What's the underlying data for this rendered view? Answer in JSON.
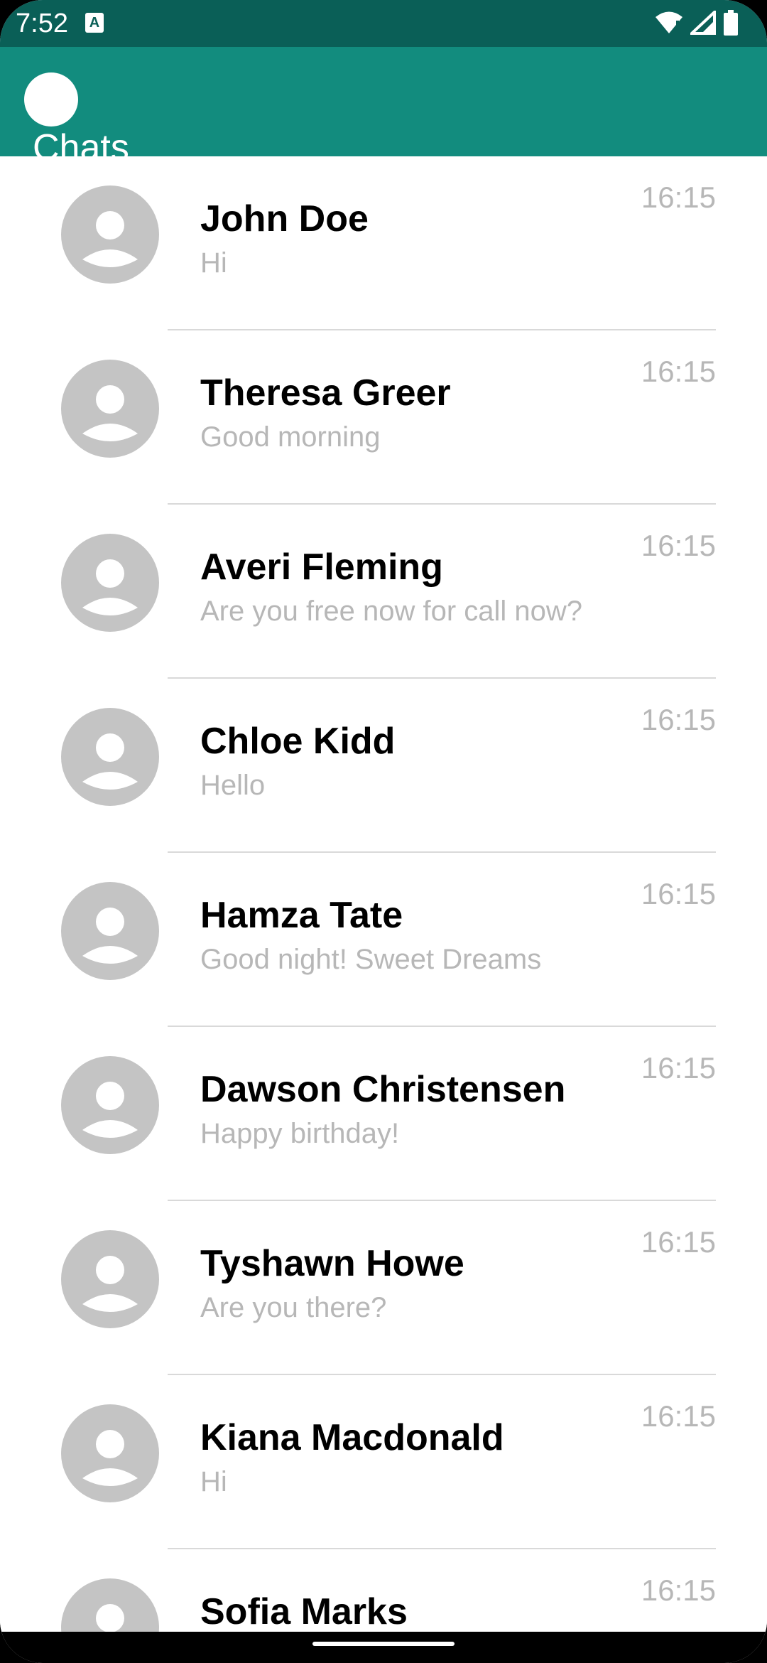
{
  "status_bar": {
    "time": "7:52",
    "a_icon": "A",
    "icons": [
      "wifi-icon",
      "cell-signal-icon",
      "battery-icon"
    ]
  },
  "app_bar": {
    "title": "Chats"
  },
  "colors": {
    "status_bar": "#0a5f57",
    "app_bar": "#128c7e",
    "avatar": "#c4c4c4",
    "secondary_text": "#b7b7b7"
  },
  "chats": [
    {
      "name": "John Doe",
      "message": "Hi",
      "time": "16:15"
    },
    {
      "name": "Theresa Greer",
      "message": "Good morning",
      "time": "16:15"
    },
    {
      "name": "Averi Fleming",
      "message": "Are you free now for call now?",
      "time": "16:15"
    },
    {
      "name": "Chloe Kidd",
      "message": "Hello",
      "time": "16:15"
    },
    {
      "name": "Hamza Tate",
      "message": "Good night! Sweet Dreams",
      "time": "16:15"
    },
    {
      "name": "Dawson Christensen",
      "message": "Happy birthday!",
      "time": "16:15"
    },
    {
      "name": "Tyshawn Howe",
      "message": "Are you there?",
      "time": "16:15"
    },
    {
      "name": "Kiana Macdonald",
      "message": "Hi",
      "time": "16:15"
    },
    {
      "name": "Sofia Marks",
      "message": "",
      "time": "16:15"
    }
  ]
}
